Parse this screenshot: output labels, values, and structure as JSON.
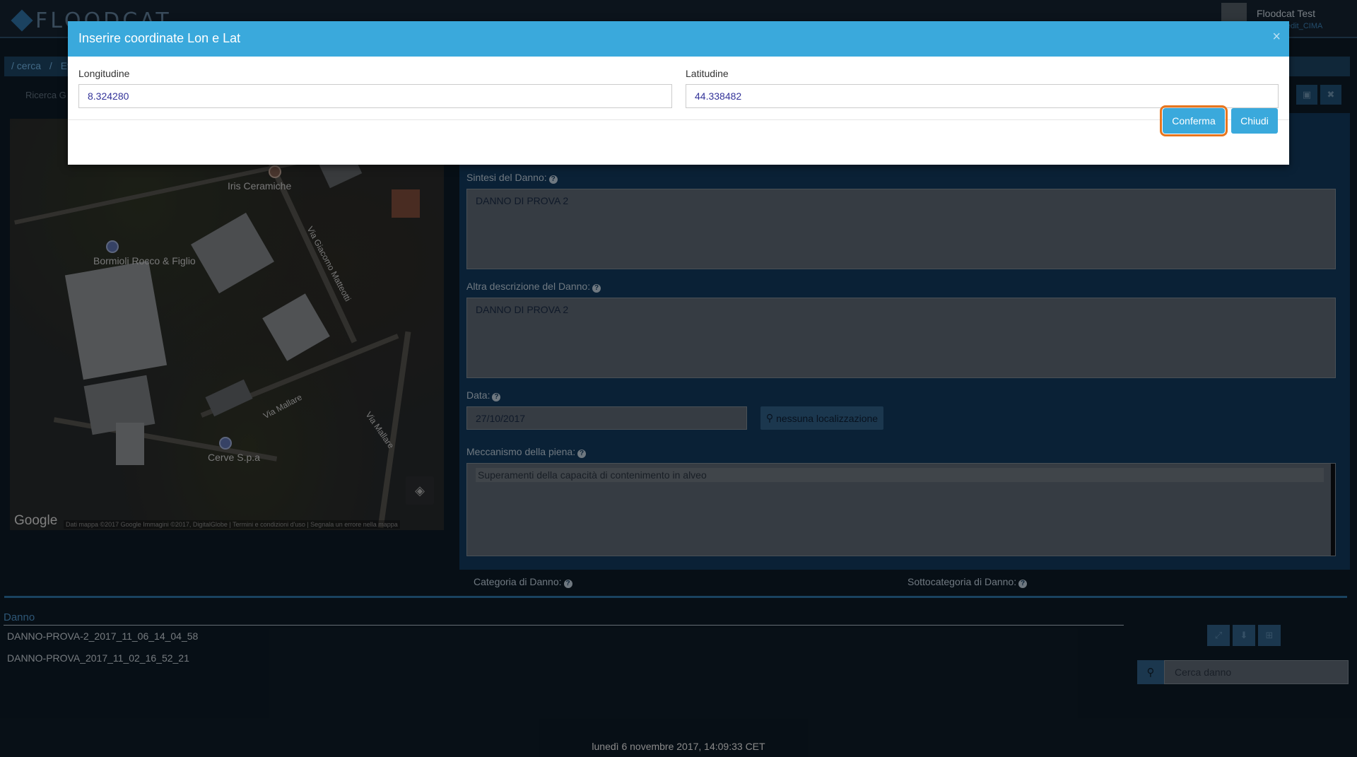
{
  "app": {
    "logo_text": "FLOODCAT",
    "user_name": "Floodcat Test",
    "user_role": "edit_CIMA"
  },
  "breadcrumb": [
    "/ cerca",
    "/",
    "Ev"
  ],
  "search_geo_label": "Ricerca G",
  "map": {
    "labels": {
      "iris": "Iris Ceramiche",
      "bormioli": "Bormioli Rocco & Figlio",
      "cerve": "Cerve S.p.a",
      "via_matteotti": "Via Giacomo Matteotti",
      "via_mallare_1": "Via Mallare",
      "via_mallare_2": "Via Mallare"
    },
    "google": "Google",
    "attribution": "Dati mappa ©2017 Google Immagini ©2017, DigitalGlobe | Termini e condizioni d'uso | Segnala un errore nella mappa"
  },
  "form": {
    "sintesi_label": "Sintesi del Danno:",
    "sintesi_value": "DANNO DI PROVA 2",
    "altra_label": "Altra descrizione del Danno:",
    "altra_value": "DANNO DI PROVA 2",
    "data_label": "Data:",
    "data_value": "27/10/2017",
    "localizzazione_button": "nessuna localizzazione",
    "meccanismo_label": "Meccanismo della piena:",
    "meccanismo_option": "Superamenti della capacità di contenimento in alveo",
    "categoria_label": "Categoria di Danno:",
    "sottocategoria_label": "Sottocategoria di Danno:"
  },
  "list": {
    "tab": "Danno",
    "items": [
      "DANNO-PROVA-2_2017_11_06_14_04_58",
      "DANNO-PROVA_2017_11_02_16_52_21"
    ],
    "search_placeholder": "Cerca danno"
  },
  "status_bar": "lunedì 6 novembre 2017, 14:09:33 CET",
  "modal": {
    "title": "Inserire coordinate Lon e Lat",
    "close": "×",
    "longitude_label": "Longitudine",
    "longitude_value": "8.324280",
    "latitude_label": "Latitudine",
    "latitude_value": "44.338482",
    "confirm_label": "Conferma",
    "close_label": "Chiudi"
  },
  "colors": {
    "modal_header": "#3aa9dc",
    "focus_outline": "#e8761e"
  }
}
